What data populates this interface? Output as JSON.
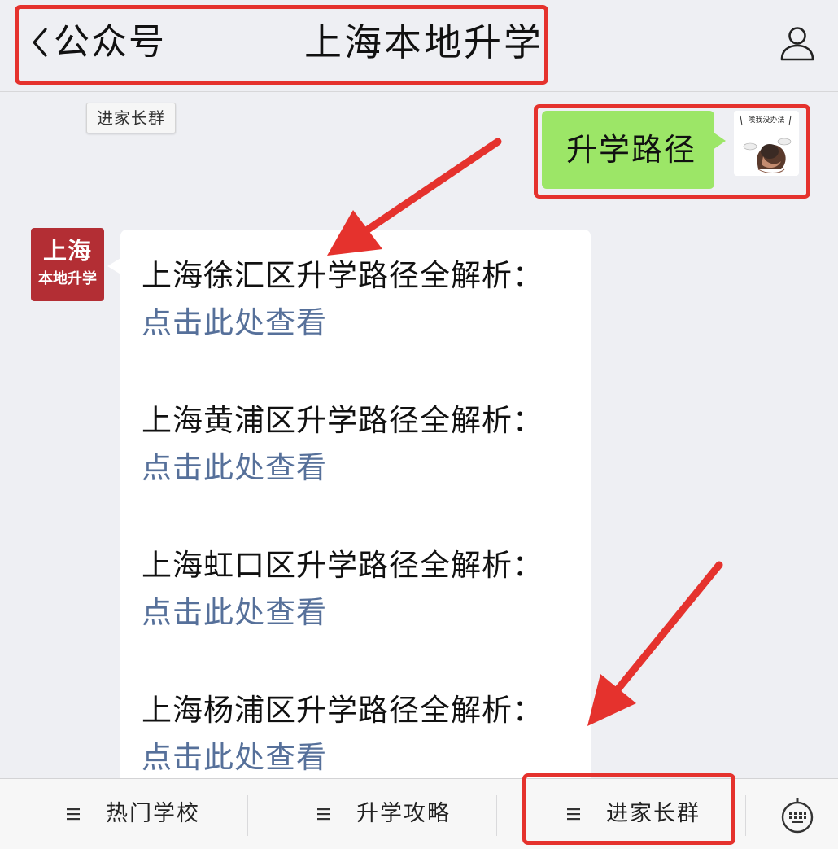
{
  "header": {
    "back_label": "公众号",
    "title": "上海本地升学"
  },
  "chat": {
    "time_chip": "进家长群",
    "user_message": "升学路径",
    "user_sticker_text": "唉我没办法",
    "account_avatar": {
      "line1": "上海",
      "line2": "本地升学",
      "color": "#b32e34"
    },
    "items": [
      {
        "title": "上海徐汇区升学路径全解析：",
        "link": "点击此处查看"
      },
      {
        "title": "上海黄浦区升学路径全解析：",
        "link": "点击此处查看"
      },
      {
        "title": "上海虹口区升学路径全解析：",
        "link": "点击此处查看"
      },
      {
        "title": "上海杨浦区升学路径全解析：",
        "link": "点击此处查看"
      }
    ]
  },
  "bottom_menu": {
    "items": [
      {
        "label": "热门学校",
        "icon": "hamburger-icon"
      },
      {
        "label": "升学攻略",
        "icon": "hamburger-icon"
      },
      {
        "label": "进家长群",
        "icon": "hamburger-icon"
      }
    ],
    "keyboard_icon": "keyboard-icon"
  },
  "colors": {
    "background": "#eeeff3",
    "user_bubble": "#9ce667",
    "link": "#56709a",
    "annotation_red": "#e5322d",
    "account_avatar": "#b32e34"
  }
}
